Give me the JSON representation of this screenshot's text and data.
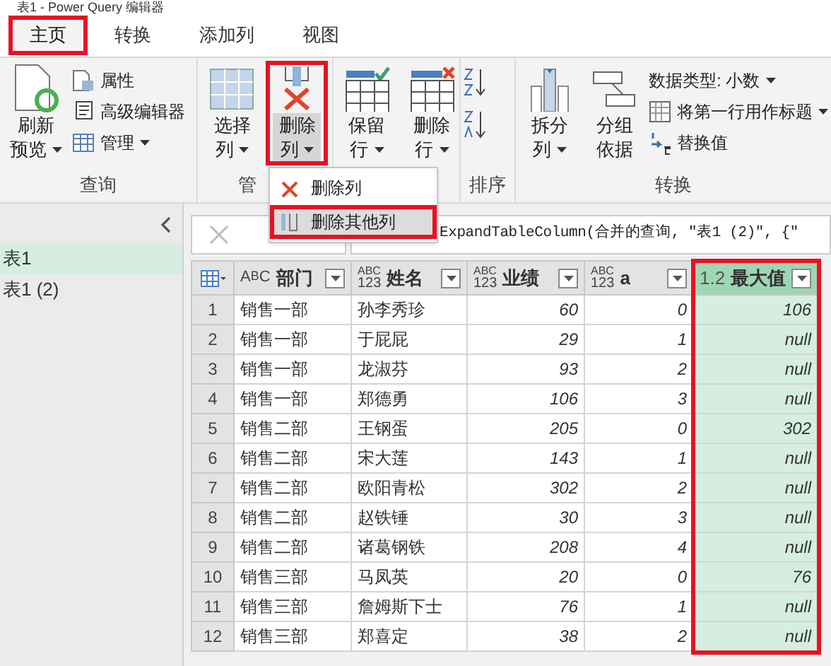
{
  "window": {
    "title": "表1 - Power Query 编辑器"
  },
  "tabs": [
    {
      "label": "主页",
      "selected": true,
      "highlighted": true
    },
    {
      "label": "转换",
      "selected": false,
      "highlighted": false
    },
    {
      "label": "添加列",
      "selected": false,
      "highlighted": false
    },
    {
      "label": "视图",
      "selected": false,
      "highlighted": false
    }
  ],
  "ribbon": {
    "groups": [
      {
        "label": "查询",
        "buttons": [
          {
            "kind": "large",
            "lines": [
              "刷新",
              "预览"
            ],
            "dropdown": true,
            "highlighted": false
          },
          {
            "kind": "small",
            "label": "属性",
            "dropdown": false
          },
          {
            "kind": "small",
            "label": "高级编辑器",
            "dropdown": false
          },
          {
            "kind": "small",
            "label": "管理",
            "dropdown": true
          }
        ]
      },
      {
        "label": "管",
        "buttons": [
          {
            "kind": "large",
            "lines": [
              "选择",
              "列"
            ],
            "dropdown": true,
            "highlighted": false
          },
          {
            "kind": "large",
            "lines": [
              "删除",
              "列"
            ],
            "dropdown": true,
            "highlighted": true
          }
        ]
      },
      {
        "buttons": [
          {
            "kind": "large",
            "lines": [
              "保留",
              "行"
            ],
            "dropdown": true,
            "highlighted": false
          },
          {
            "kind": "large",
            "lines": [
              "删除",
              "行"
            ],
            "dropdown": true,
            "highlighted": false
          }
        ]
      },
      {
        "label": "排序",
        "buttons": [
          {
            "kind": "sort"
          }
        ]
      },
      {
        "label": "转换",
        "buttons": [
          {
            "kind": "large",
            "lines": [
              "拆分",
              "列"
            ],
            "dropdown": true,
            "highlighted": false
          },
          {
            "kind": "large",
            "lines": [
              "分组",
              "依据"
            ],
            "dropdown": false,
            "highlighted": false
          },
          {
            "kind": "small",
            "label": "数据类型: 小数",
            "dropdown": true
          },
          {
            "kind": "small",
            "label": "将第一行用作标题",
            "dropdown": true
          },
          {
            "kind": "small",
            "label": "替换值",
            "dropdown": false
          }
        ]
      }
    ]
  },
  "menu": {
    "items": [
      {
        "label": "删除列",
        "highlighted": false
      },
      {
        "label": "删除其他列",
        "highlighted": true
      }
    ]
  },
  "queries": [
    {
      "label": "表1",
      "selected": true
    },
    {
      "label": "表1 (2)",
      "selected": false
    }
  ],
  "formula": "ExpandTableColumn(合并的查询, \"表1 (2)\", {\"",
  "table": {
    "columns": [
      {
        "type_label": [
          "A",
          "B",
          "C"
        ],
        "kind": "text",
        "name": "部门",
        "highlighted": false
      },
      {
        "type_label": [
          "ABC",
          "123"
        ],
        "kind": "text",
        "name": "姓名",
        "highlighted": false
      },
      {
        "type_label": [
          "ABC",
          "123"
        ],
        "kind": "number",
        "name": "业绩",
        "highlighted": false
      },
      {
        "type_label": [
          "ABC",
          "123"
        ],
        "kind": "number",
        "name": "a",
        "highlighted": false
      },
      {
        "type_label": [
          "1.2"
        ],
        "kind": "number",
        "name": "最大值",
        "highlighted": true
      }
    ],
    "rows": [
      {
        "number": "1",
        "cells": [
          "销售一部",
          "孙李秀珍",
          "60",
          "0",
          "106"
        ]
      },
      {
        "number": "2",
        "cells": [
          "销售一部",
          "于屁屁",
          "29",
          "1",
          "null"
        ]
      },
      {
        "number": "3",
        "cells": [
          "销售一部",
          "龙淑芬",
          "93",
          "2",
          "null"
        ]
      },
      {
        "number": "4",
        "cells": [
          "销售一部",
          "郑德勇",
          "106",
          "3",
          "null"
        ]
      },
      {
        "number": "5",
        "cells": [
          "销售二部",
          "王钢蛋",
          "205",
          "0",
          "302"
        ]
      },
      {
        "number": "6",
        "cells": [
          "销售二部",
          "宋大莲",
          "143",
          "1",
          "null"
        ]
      },
      {
        "number": "7",
        "cells": [
          "销售二部",
          "欧阳青松",
          "302",
          "2",
          "null"
        ]
      },
      {
        "number": "8",
        "cells": [
          "销售二部",
          "赵铁锤",
          "30",
          "3",
          "null"
        ]
      },
      {
        "number": "9",
        "cells": [
          "销售二部",
          "诸葛钢铁",
          "208",
          "4",
          "null"
        ]
      },
      {
        "number": "10",
        "cells": [
          "销售三部",
          "马凤英",
          "20",
          "0",
          "76"
        ]
      },
      {
        "number": "11",
        "cells": [
          "销售三部",
          "詹姆斯下士",
          "76",
          "1",
          "null"
        ]
      },
      {
        "number": "12",
        "cells": [
          "销售三部",
          "郑喜定",
          "38",
          "2",
          "null"
        ]
      }
    ]
  }
}
